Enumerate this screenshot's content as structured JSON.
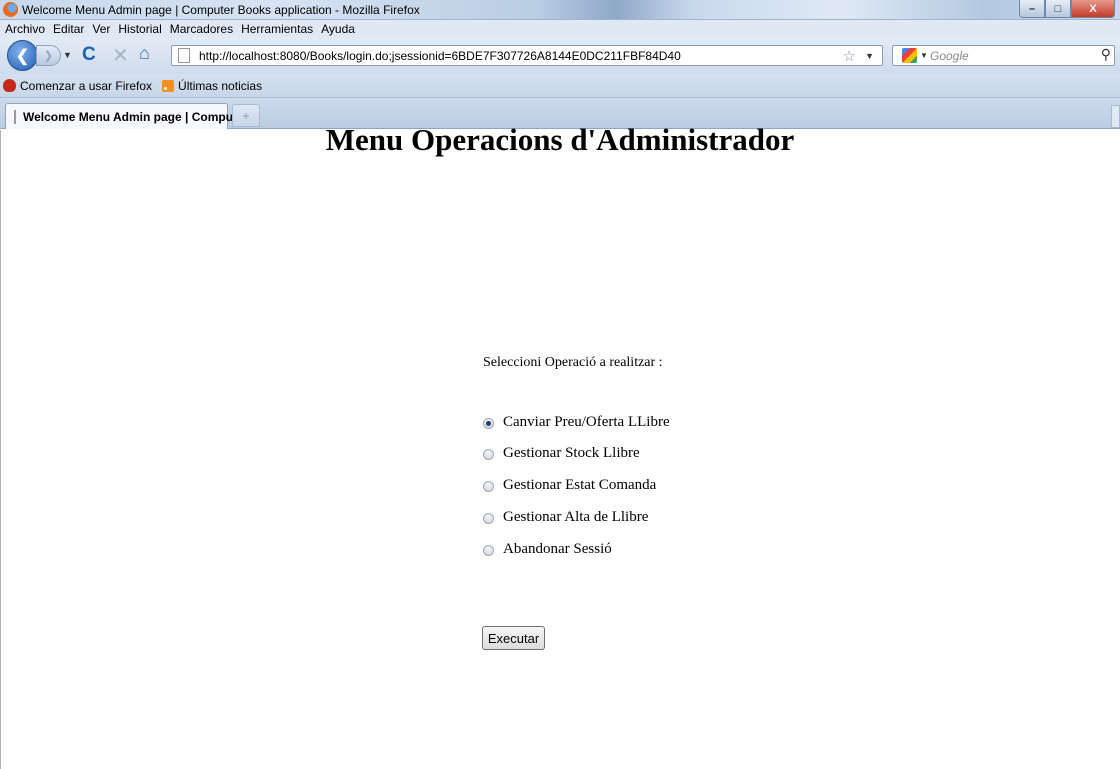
{
  "window": {
    "title": "Welcome Menu Admin page | Computer Books application - Mozilla Firefox",
    "minimize": "–",
    "maximize": "□",
    "close": "X"
  },
  "menubar": [
    "Archivo",
    "Editar",
    "Ver",
    "Historial",
    "Marcadores",
    "Herramientas",
    "Ayuda"
  ],
  "nav": {
    "url": "http://localhost:8080/Books/login.do;jsessionid=6BDE7F307726A8144E0DC211FBF84D40",
    "search_placeholder": "Google"
  },
  "bookmarks": [
    "Comenzar a usar Firefox",
    "Últimas noticias"
  ],
  "tabs": [
    {
      "label": "Welcome Menu Admin page | Compu...",
      "active": true
    }
  ],
  "page": {
    "title": "Menu Operacions d'Administrador",
    "prompt": "Seleccioni Operació a realitzar :",
    "options": [
      {
        "label": "Canviar Preu/Oferta LLibre",
        "checked": true
      },
      {
        "label": "Gestionar Stock Llibre",
        "checked": false
      },
      {
        "label": "Gestionar Estat Comanda",
        "checked": false
      },
      {
        "label": "Gestionar Alta de Llibre",
        "checked": false
      },
      {
        "label": "Abandonar Sessió",
        "checked": false
      }
    ],
    "submit_label": "Executar"
  },
  "icons": {
    "back": "back-arrow-icon",
    "forward": "forward-arrow-icon",
    "reload": "reload-icon",
    "stop": "stop-icon",
    "home": "home-icon",
    "bookmark_star": "star-icon",
    "search": "magnifier-icon"
  }
}
